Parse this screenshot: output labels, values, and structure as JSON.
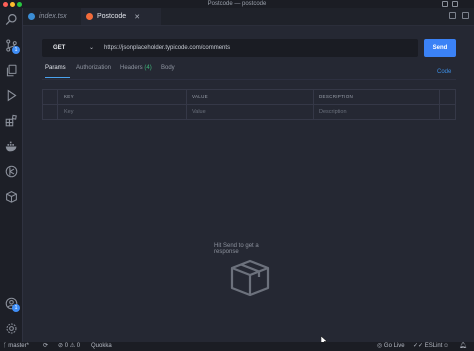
{
  "window": {
    "title": "Postcode — postcode"
  },
  "tabs": [
    {
      "label": "index.tsx",
      "active": false
    },
    {
      "label": "Postcode",
      "active": true
    }
  ],
  "request": {
    "method": "GET",
    "url": "https://jsonplaceholder.typicode.com/comments",
    "send_label": "Send"
  },
  "subtabs": {
    "params": "Params",
    "authorization": "Authorization",
    "headers": "Headers",
    "headers_count": "(4)",
    "body": "Body",
    "code": "Code"
  },
  "params_table": {
    "headers": [
      "KEY",
      "VALUE",
      "DESCRIPTION"
    ],
    "placeholders": [
      "Key",
      "Value",
      "Description"
    ]
  },
  "empty_state": {
    "message": "Hit Send to get a response"
  },
  "activity_bar": {
    "badges": {
      "source_control": "1",
      "accounts": "1"
    }
  },
  "status_bar": {
    "branch": "master*",
    "errors": "0",
    "warnings": "0",
    "quokka": "Quokka",
    "go_live": "Go Live",
    "eslint": "ESLint"
  },
  "colors": {
    "accent": "#3b82f6",
    "editor_bg": "#252833",
    "headers_count": "#3fb67a"
  }
}
